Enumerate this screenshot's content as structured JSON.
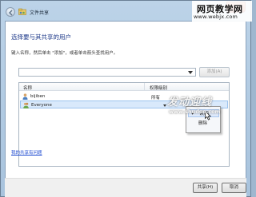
{
  "window": {
    "title": "文件共享",
    "close_glyph": "x"
  },
  "content": {
    "heading": "选择要与其共享的用户",
    "instruction": "键入名称，然后单击 \"添加\"，或者单击箭头查找用户。",
    "dropdown_value": "",
    "add_button": "添加(A)"
  },
  "list": {
    "columns": [
      "名称",
      "权限级别"
    ],
    "rows": [
      {
        "name": "bijiben",
        "permission": "所有"
      },
      {
        "name": "Everyone",
        "permission": ""
      }
    ]
  },
  "context_menu": {
    "items": [
      {
        "label": "读/写",
        "checked": true
      },
      {
        "label": "删除",
        "checked": false
      }
    ]
  },
  "help_link": "我的共享有问题",
  "footer": {
    "share_button": "共享(H)",
    "cancel_button": "取消"
  },
  "watermarks": {
    "top_line1": "网页教学网",
    "top_line2": "www.webjx.com",
    "middle_line1": "发动迎线",
    "middle_line2": "www.shudoo.com"
  },
  "colors": {
    "accent_heading": "#1e3a8a",
    "link": "#1e4bd1",
    "selection": "#d9e9fb",
    "close_button": "#c7452c"
  },
  "icons": {
    "back": "back-arrow-icon",
    "share": "share-folder-icon",
    "user": "user-icon",
    "check": "check-icon",
    "cursor": "mouse-cursor-icon"
  }
}
